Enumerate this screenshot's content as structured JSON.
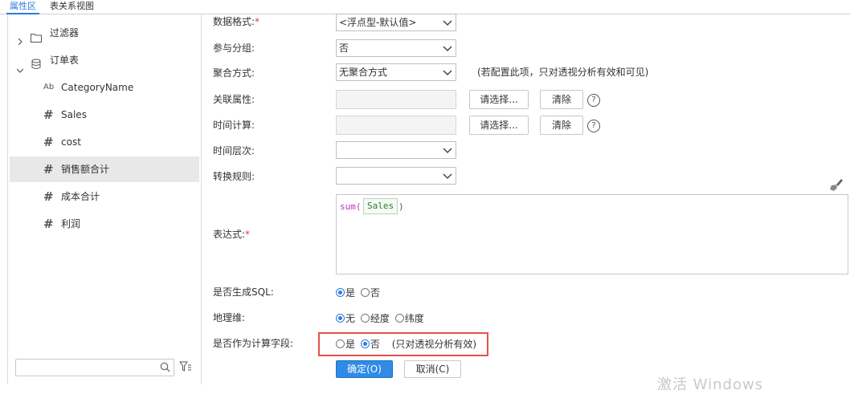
{
  "tabs": [
    "属性区",
    "表关系视图"
  ],
  "tree": {
    "items": [
      {
        "label": "过滤器",
        "icon": "folder-icon",
        "expand": "chevron-right"
      },
      {
        "label": "订单表",
        "icon": "table-icon",
        "expand": "chevron-down"
      },
      {
        "label": "CategoryName",
        "icon": "text-field-icon",
        "badge": "Ab"
      },
      {
        "label": "Sales",
        "icon": "number-field-icon",
        "badge": "#"
      },
      {
        "label": "cost",
        "icon": "number-field-icon",
        "badge": "#"
      },
      {
        "label": "销售额合计",
        "icon": "number-field-icon",
        "badge": "#",
        "selected": true
      },
      {
        "label": "成本合计",
        "icon": "number-field-icon",
        "badge": "#"
      },
      {
        "label": "利润",
        "icon": "number-field-icon",
        "badge": "#"
      }
    ],
    "search_placeholder": ""
  },
  "form": {
    "data_format": {
      "label": "数据格式:",
      "req": "*",
      "value": "<浮点型-默认值>"
    },
    "group": {
      "label": "参与分组:",
      "value": "否"
    },
    "agg": {
      "label": "聚合方式:",
      "value": "无聚合方式",
      "hint": "(若配置此项，只对透视分析有效和可见)"
    },
    "rel_attr": {
      "label": "关联属性:",
      "choose": "请选择...",
      "clear": "清除",
      "help": "?"
    },
    "time_calc": {
      "label": "时间计算:",
      "choose": "请选择...",
      "clear": "清除",
      "help": "?"
    },
    "time_level": {
      "label": "时间层次:",
      "value": ""
    },
    "convert_rule": {
      "label": "转换规则:",
      "value": ""
    },
    "expr": {
      "label": "表达式:",
      "req": "*",
      "func": "sum(",
      "field": "Sales",
      "close": ")"
    },
    "gen_sql": {
      "label": "是否生成SQL:",
      "options": [
        "是",
        "否"
      ],
      "selected": 0
    },
    "geo": {
      "label": "地理维:",
      "options": [
        "无",
        "经度",
        "纬度"
      ],
      "selected": 0
    },
    "calc_field": {
      "label": "是否作为计算字段:",
      "options": [
        "是",
        "否"
      ],
      "selected": 1,
      "note": "(只对透视分析有效)"
    },
    "ok": "确定(O)",
    "cancel": "取消(C)"
  },
  "watermark": "激活 Windows",
  "colors": {
    "accent": "#2a7ae2",
    "highlight_border": "#e2534b",
    "required": "#e23a3a",
    "func": "#c030c0",
    "field": "#2a7a2a"
  }
}
